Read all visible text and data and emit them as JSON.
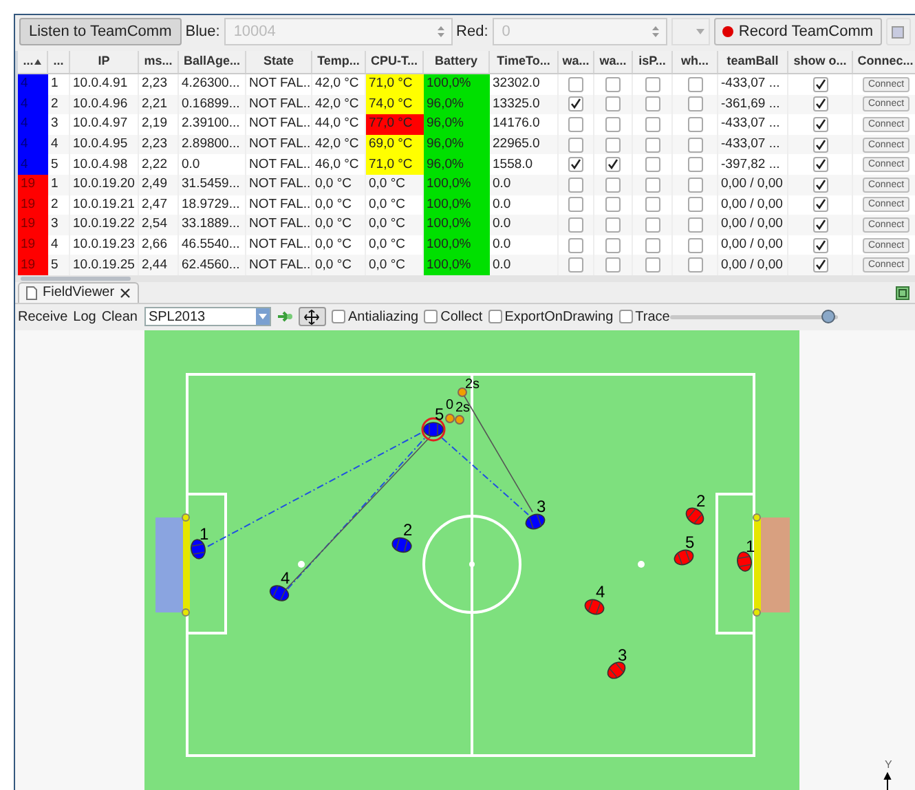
{
  "toolbar": {
    "listen_button": "Listen to TeamComm",
    "blue_label": "Blue:",
    "blue_value": "10004",
    "red_label": "Red:",
    "red_value": "0",
    "record_button": "Record TeamComm"
  },
  "table": {
    "columns": [
      {
        "label": "...",
        "sorted": true
      },
      {
        "label": "..."
      },
      {
        "label": "IP"
      },
      {
        "label": "ms..."
      },
      {
        "label": "BallAge..."
      },
      {
        "label": "State"
      },
      {
        "label": "Temp..."
      },
      {
        "label": "CPU-T..."
      },
      {
        "label": "Battery"
      },
      {
        "label": "TimeTo..."
      },
      {
        "label": "wa..."
      },
      {
        "label": "wa..."
      },
      {
        "label": "isP..."
      },
      {
        "label": "wh..."
      },
      {
        "label": "teamBall"
      },
      {
        "label": "show o..."
      },
      {
        "label": "Connec..."
      }
    ],
    "rows": [
      {
        "cells": [
          {
            "text": "4",
            "color": "#0000ff"
          },
          "1",
          "10.0.4.91",
          "2,23",
          "4.26300...",
          "NOT FAL...",
          "42,0 °C",
          {
            "text": "71,0 °C",
            "color": "#ffff00"
          },
          {
            "text": "100,0%",
            "color": "#00e000"
          },
          "32302.0",
          false,
          false,
          false,
          false,
          "-433,07 ...",
          true,
          {
            "kind": "button",
            "label": "Connect"
          }
        ]
      },
      {
        "cells": [
          {
            "text": "4",
            "color": "#0000ff"
          },
          "2",
          "10.0.4.96",
          "2,21",
          "0.16899...",
          "NOT FAL...",
          "42,0 °C",
          {
            "text": "74,0 °C",
            "color": "#ffff00"
          },
          {
            "text": "96,0%",
            "color": "#00e000"
          },
          "13325.0",
          true,
          false,
          false,
          false,
          "-361,69 ...",
          true,
          {
            "kind": "button",
            "label": "Connect"
          }
        ]
      },
      {
        "cells": [
          {
            "text": "4",
            "color": "#0000ff"
          },
          "3",
          "10.0.4.97",
          "2,19",
          "2.39100...",
          "NOT FAL...",
          "44,0 °C",
          {
            "text": "77,0 °C",
            "color": "#ff0000"
          },
          {
            "text": "96,0%",
            "color": "#00e000"
          },
          "14176.0",
          false,
          false,
          false,
          false,
          "-433,07 ...",
          true,
          {
            "kind": "button",
            "label": "Connect"
          }
        ]
      },
      {
        "cells": [
          {
            "text": "4",
            "color": "#0000ff"
          },
          "4",
          "10.0.4.95",
          "2,23",
          "2.89800...",
          "NOT FAL...",
          "42,0 °C",
          {
            "text": "69,0 °C",
            "color": "#ffff00"
          },
          {
            "text": "96,0%",
            "color": "#00e000"
          },
          "22965.0",
          false,
          false,
          false,
          false,
          "-433,07 ...",
          true,
          {
            "kind": "button",
            "label": "Connect"
          }
        ]
      },
      {
        "cells": [
          {
            "text": "4",
            "color": "#0000ff"
          },
          "5",
          "10.0.4.98",
          "2,22",
          "0.0",
          "NOT FAL...",
          "46,0 °C",
          {
            "text": "71,0 °C",
            "color": "#ffff00"
          },
          {
            "text": "96,0%",
            "color": "#00e000"
          },
          "1558.0",
          true,
          true,
          false,
          false,
          "-397,82 ...",
          true,
          {
            "kind": "button",
            "label": "Connect"
          }
        ]
      },
      {
        "cells": [
          {
            "text": "19",
            "color": "#ff0000"
          },
          "1",
          "10.0.19.20",
          "2,49",
          "31.5459...",
          "NOT FAL...",
          "0,0 °C",
          "0,0 °C",
          {
            "text": "100,0%",
            "color": "#00e000"
          },
          "0.0",
          false,
          false,
          false,
          false,
          "0,00 / 0,00",
          true,
          {
            "kind": "button",
            "label": "Connect"
          }
        ]
      },
      {
        "cells": [
          {
            "text": "19",
            "color": "#ff0000"
          },
          "2",
          "10.0.19.21",
          "2,47",
          "18.9729...",
          "NOT FAL...",
          "0,0 °C",
          "0,0 °C",
          {
            "text": "100,0%",
            "color": "#00e000"
          },
          "0.0",
          false,
          false,
          false,
          false,
          "0,00 / 0,00",
          true,
          {
            "kind": "button",
            "label": "Connect"
          }
        ]
      },
      {
        "cells": [
          {
            "text": "19",
            "color": "#ff0000"
          },
          "3",
          "10.0.19.22",
          "2,54",
          "33.1889...",
          "NOT FAL...",
          "0,0 °C",
          "0,0 °C",
          {
            "text": "100,0%",
            "color": "#00e000"
          },
          "0.0",
          false,
          false,
          false,
          false,
          "0,00 / 0,00",
          true,
          {
            "kind": "button",
            "label": "Connect"
          }
        ]
      },
      {
        "cells": [
          {
            "text": "19",
            "color": "#ff0000"
          },
          "4",
          "10.0.19.23",
          "2,66",
          "46.5540...",
          "NOT FAL...",
          "0,0 °C",
          "0,0 °C",
          {
            "text": "100,0%",
            "color": "#00e000"
          },
          "0.0",
          false,
          false,
          false,
          false,
          "0,00 / 0,00",
          true,
          {
            "kind": "button",
            "label": "Connect"
          }
        ]
      },
      {
        "cells": [
          {
            "text": "19",
            "color": "#ff0000"
          },
          "5",
          "10.0.19.25",
          "2,44",
          "62.4560...",
          "NOT FAL...",
          "0,0 °C",
          "0,0 °C",
          {
            "text": "100,0%",
            "color": "#00e000"
          },
          "0.0",
          false,
          false,
          false,
          false,
          "0,00 / 0,00",
          true,
          {
            "kind": "button",
            "label": "Connect"
          }
        ]
      }
    ]
  },
  "field_viewer": {
    "tab": {
      "title": "FieldViewer",
      "selected": true
    },
    "toolbar": {
      "actions": [
        "Receive",
        "Log",
        "Clean"
      ],
      "mode": "SPL2013",
      "checkboxes": [
        {
          "label": "Antialiazing",
          "checked": false
        },
        {
          "label": "Collect",
          "checked": false
        },
        {
          "label": "ExportOnDrawing",
          "checked": false
        },
        {
          "label": "Trace",
          "checked": false
        }
      ],
      "slider": {
        "level": 0.94
      }
    },
    "robots": [
      {
        "label": "1",
        "color": "#0000ff",
        "selected": false
      },
      {
        "label": "2",
        "color": "#0000ff",
        "selected": false
      },
      {
        "label": "3",
        "color": "#0000ff",
        "selected": false
      },
      {
        "label": "4",
        "color": "#0000ff",
        "selected": false
      },
      {
        "label": "5",
        "color": "#0000ff",
        "selected": true
      },
      {
        "label": "1",
        "color": "#ff0000",
        "selected": false
      },
      {
        "label": "2",
        "color": "#ff0000",
        "selected": false
      },
      {
        "label": "3",
        "color": "#ff0000",
        "selected": false
      },
      {
        "label": "4",
        "color": "#ff0000",
        "selected": false
      },
      {
        "label": "5",
        "color": "#ff0000",
        "selected": false
      }
    ],
    "ball_markers": [
      {
        "label": "2s"
      },
      {
        "label": "0"
      },
      {
        "label": "2s"
      }
    ],
    "axis_label": "Y"
  }
}
